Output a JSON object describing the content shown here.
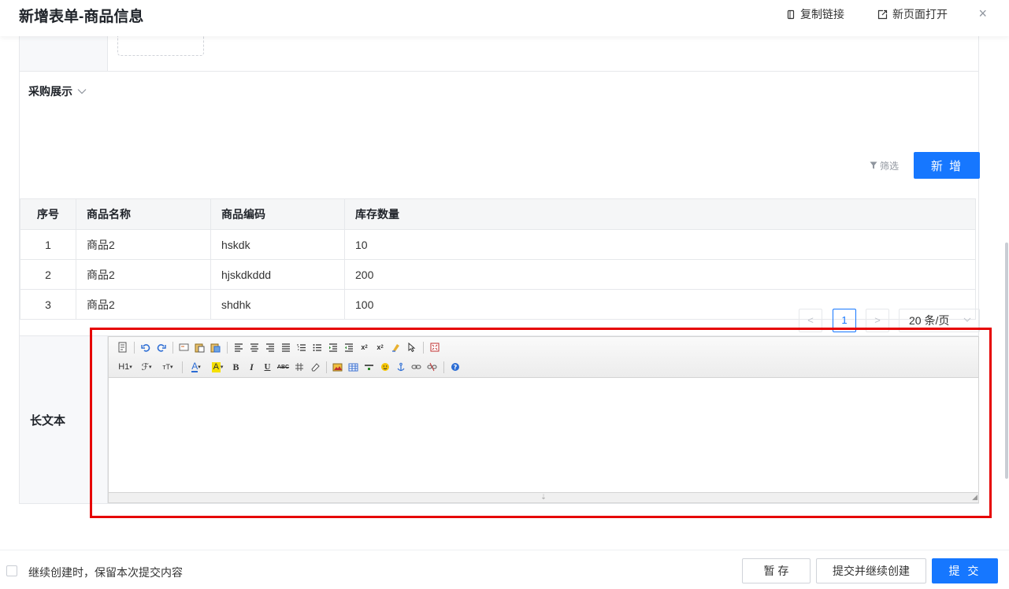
{
  "header": {
    "title": "新增表单-商品信息",
    "copy_link": "复制链接",
    "open_new_page": "新页面打开",
    "close": "×"
  },
  "section": {
    "title": "采购展示",
    "filter_label": "筛选",
    "add_button": "新 增"
  },
  "table": {
    "columns": [
      "序号",
      "商品名称",
      "商品编码",
      "库存数量"
    ],
    "rows": [
      [
        "1",
        "商品2",
        "hskdk",
        "10"
      ],
      [
        "2",
        "商品2",
        "hjskdkddd",
        "200"
      ],
      [
        "3",
        "商品2",
        "shdhk",
        "100"
      ]
    ]
  },
  "pagination": {
    "prev": "<",
    "current_page": "1",
    "next": ">",
    "page_size": "20 条/页"
  },
  "longtext": {
    "label": "长文本",
    "toolbar_row1": [
      "source-icon",
      "undo-icon",
      "redo-icon",
      "cut-icon",
      "paste-icon",
      "paste-text-icon",
      "align-left-icon",
      "align-center-icon",
      "align-right-icon",
      "align-justify-icon",
      "ordered-list-icon",
      "unordered-list-icon",
      "indent-icon",
      "outdent-icon",
      "subscript-icon",
      "superscript-icon",
      "clear-format-icon",
      "select-all-icon",
      "fullscreen-icon"
    ],
    "toolbar_row2": [
      "heading-icon",
      "font-family-icon",
      "font-size-icon",
      "font-color-icon",
      "background-color-icon",
      "bold-icon",
      "italic-icon",
      "underline-icon",
      "strikethrough-icon",
      "table-icon",
      "eraser-icon",
      "image-icon",
      "insert-table-icon",
      "horizontal-rule-icon",
      "emoji-icon",
      "anchor-icon",
      "link-icon",
      "unlink-icon",
      "help-icon"
    ],
    "tb_h1": "H1",
    "tb_font": "ℱ",
    "tb_size": "тT",
    "tb_color": "A",
    "tb_bg": "A",
    "tb_bold": "B",
    "tb_italic": "I",
    "tb_underline": "U",
    "tb_strike": "ABC"
  },
  "footer": {
    "keep_label": "继续创建时，保留本次提交内容",
    "save_draft": "暂 存",
    "submit_continue": "提交并继续创建",
    "submit": "提 交"
  },
  "colors": {
    "primary": "#1677ff",
    "highlight": "#e60000"
  }
}
